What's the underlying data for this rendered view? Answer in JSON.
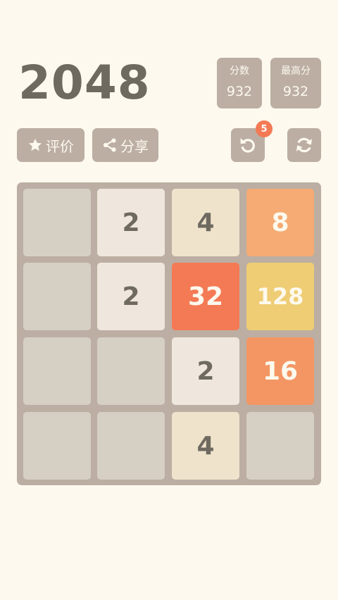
{
  "header": {
    "title": "2048",
    "score_label": "分数",
    "score_value": "932",
    "best_label": "最高分",
    "best_value": "932"
  },
  "toolbar": {
    "rate_label": "评价",
    "share_label": "分享",
    "undo_count": "5",
    "icons": {
      "rate": "star-icon",
      "share": "share-icon",
      "undo": "undo-icon",
      "restart": "refresh-icon"
    }
  },
  "colors": {
    "background": "#fdf9ee",
    "board": "#bcaea2",
    "empty_cell": "#d6cfc4",
    "badge": "#f47a55"
  },
  "board": {
    "rows": [
      [
        "",
        "2",
        "4",
        "8"
      ],
      [
        "",
        "2",
        "32",
        "128"
      ],
      [
        "",
        "",
        "2",
        "16"
      ],
      [
        "",
        "",
        "4",
        ""
      ]
    ],
    "tile_colors": {
      "2": "#efe7dd",
      "4": "#efe3cc",
      "8": "#f5ab73",
      "16": "#f39663",
      "32": "#f47a55",
      "128": "#efcd74"
    }
  }
}
